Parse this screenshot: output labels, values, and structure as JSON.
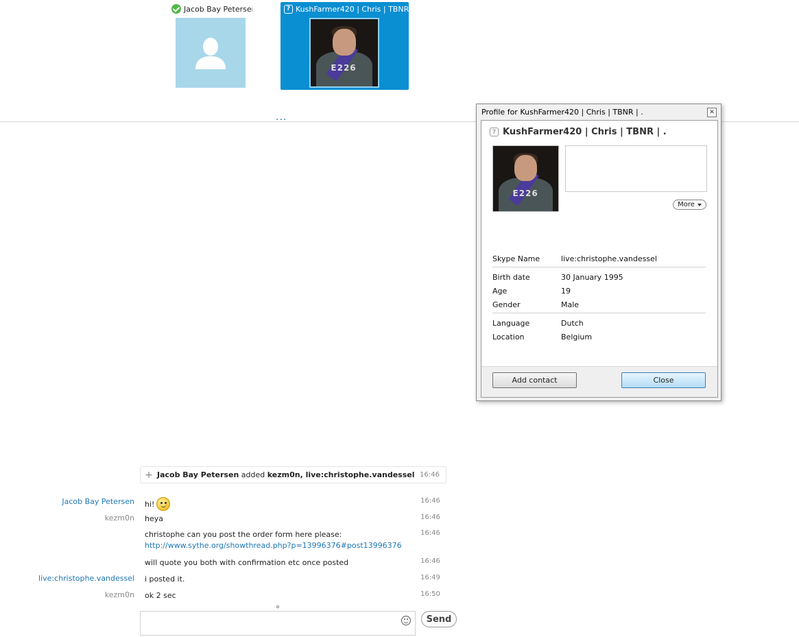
{
  "participants": [
    {
      "name": "Jacob Bay Petersen",
      "status_icon": "online-check-icon",
      "avatar": "default-avatar-icon"
    },
    {
      "name": "KushFarmer420 | Chris | TBNR | .",
      "status_icon": "skype-unknown-status-icon",
      "avatar": "photo"
    }
  ],
  "more_participants": "...",
  "profile": {
    "window_title": "Profile for KushFarmer420 | Chris | TBNR | .",
    "display_name": "KushFarmer420 | Chris | TBNR | .",
    "more_label": "More",
    "photo_text": "E226",
    "fields": [
      {
        "key": "Skype Name",
        "value": "live:christophe.vandessel"
      },
      {
        "key": "Birth date",
        "value": "30 January 1995"
      },
      {
        "key": "Age",
        "value": "19"
      },
      {
        "key": "Gender",
        "value": "Male"
      },
      {
        "key": "Language",
        "value": "Dutch"
      },
      {
        "key": "Location",
        "value": "Belgium"
      }
    ],
    "add_contact_label": "Add contact",
    "close_label": "Close"
  },
  "event": {
    "actor": "Jacob Bay Petersen",
    "verb": " added ",
    "targets": "kezm0n, live:christophe.vandessel",
    "time": "16:46"
  },
  "messages": [
    {
      "sender": "Jacob Bay Petersen",
      "text": "hi!",
      "time": "16:46"
    },
    {
      "sender": "kezm0n",
      "text": "heya",
      "time": "16:46"
    },
    {
      "sender": "",
      "text": "christophe can you post the order form here please:",
      "link": "http://www.sythe.org/showthread.php?p=13996376#post13996376",
      "time": "16:46"
    },
    {
      "sender": "",
      "text": "will quote you both with confirmation etc once posted",
      "time": "16:46"
    },
    {
      "sender": "live:christophe.vandessel",
      "text": "i posted it.",
      "time": "16:49"
    },
    {
      "sender": "kezm0n",
      "text": "ok 2 sec",
      "time": "16:50"
    }
  ],
  "composer": {
    "placeholder": "",
    "send_label": "Send"
  }
}
